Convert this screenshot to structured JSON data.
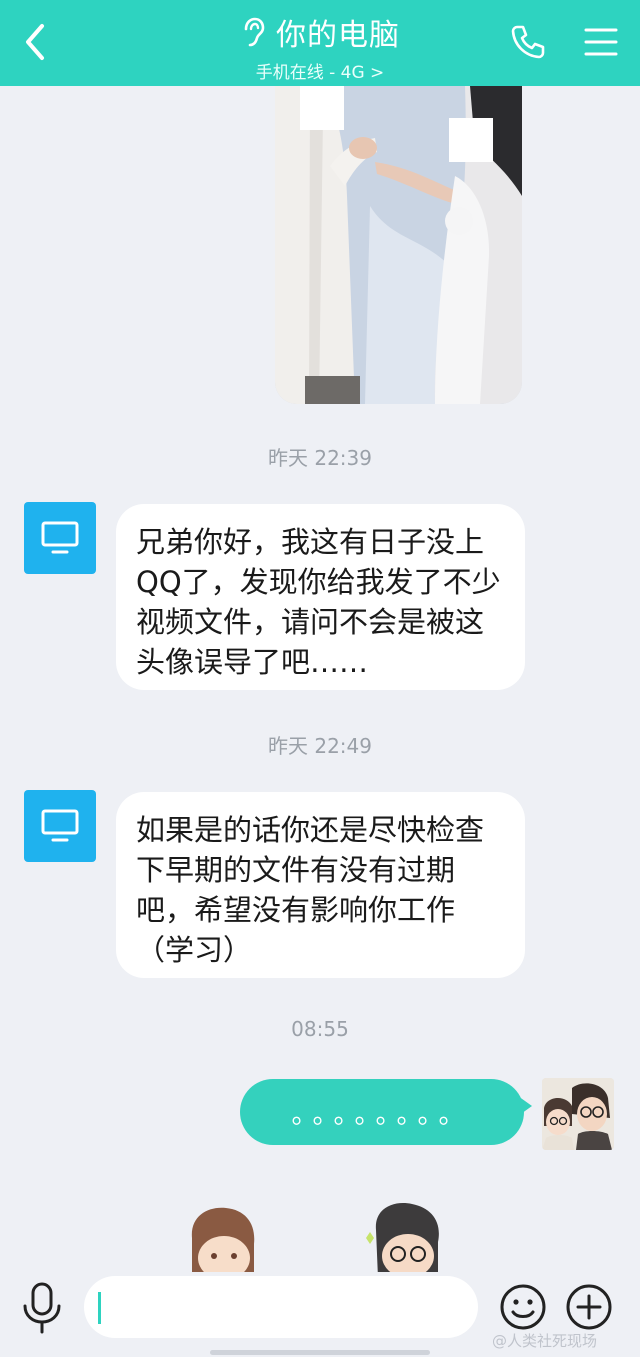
{
  "header": {
    "title": "你的电脑",
    "subtitle": "手机在线 - 4G >",
    "icons": [
      "back-arrow-icon",
      "ear-icon",
      "phone-icon",
      "menu-icon"
    ]
  },
  "messages": [
    {
      "type": "image",
      "direction": "outgoing",
      "description_icon": "photo-image"
    },
    {
      "time": "昨天 22:39"
    },
    {
      "type": "text",
      "direction": "incoming",
      "text": "兄弟你好，我这有日子没上QQ了，发现你给我发了不少视频文件，请问不会是被这头像误导了吧……"
    },
    {
      "time": "昨天 22:49"
    },
    {
      "type": "text",
      "direction": "incoming",
      "text": "如果是的话你还是尽快检查下早期的文件有没有过期吧，希望没有影响你工作（学习）"
    },
    {
      "time": "08:55"
    },
    {
      "type": "text",
      "direction": "outgoing",
      "text": "。。。。。。。。"
    }
  ],
  "input": {
    "value": "",
    "icons": [
      "microphone-icon",
      "emoji-icon",
      "plus-icon"
    ]
  },
  "watermark": "@人类社死现场",
  "colors": {
    "header": "#2ed3c0",
    "outgoing_bubble": "#34d1bd",
    "incoming_bubble": "#ffffff",
    "pc_avatar": "#1fb2ee",
    "background": "#eef0f5"
  }
}
